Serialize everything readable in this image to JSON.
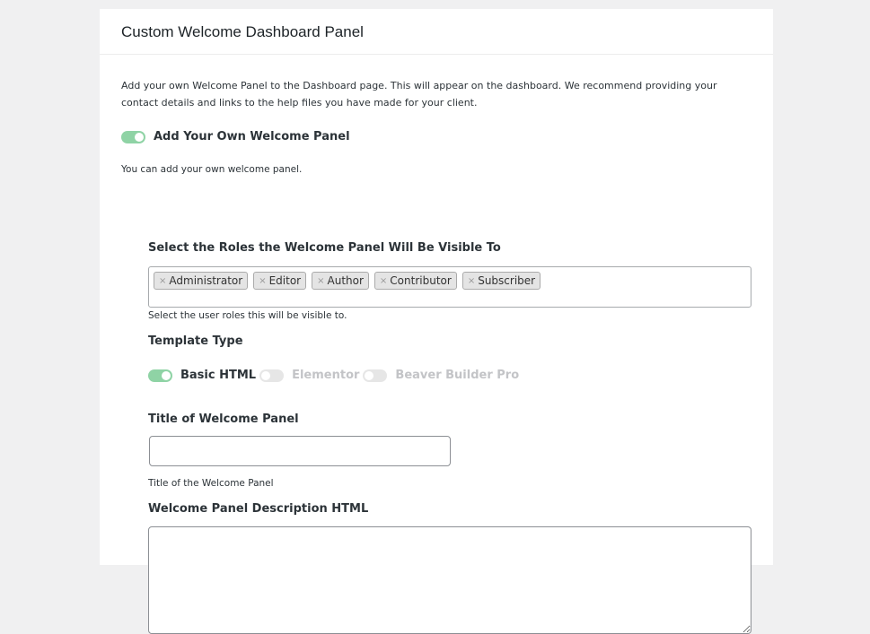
{
  "panel": {
    "title": "Custom Welcome Dashboard Panel",
    "intro": "Add your own Welcome Panel to the Dashboard page. This will appear on the dashboard. We recommend providing your contact details and links to the help files you have made for your client."
  },
  "enable_toggle": {
    "label": "Add Your Own Welcome Panel",
    "checked": true,
    "hint": "You can add your own welcome panel."
  },
  "roles": {
    "label": "Select the Roles the Welcome Panel Will Be Visible To",
    "remove_glyph": "×",
    "selected": [
      "Administrator",
      "Editor",
      "Author",
      "Contributor",
      "Subscriber"
    ],
    "hint": "Select the user roles this will be visible to."
  },
  "template_type": {
    "label": "Template Type",
    "options": [
      {
        "label": "Basic HTML",
        "checked": true
      },
      {
        "label": "Elementor",
        "checked": false
      },
      {
        "label": "Beaver Builder Pro",
        "checked": false
      }
    ]
  },
  "title_field": {
    "label": "Title of Welcome Panel",
    "value": "",
    "hint": "Title of the Welcome Panel"
  },
  "description_field": {
    "label": "Welcome Panel Description HTML",
    "value": ""
  },
  "colors": {
    "toggle_on": "#8fd3a5",
    "toggle_off": "#e6e6e6",
    "background": "#f0f0f1"
  }
}
